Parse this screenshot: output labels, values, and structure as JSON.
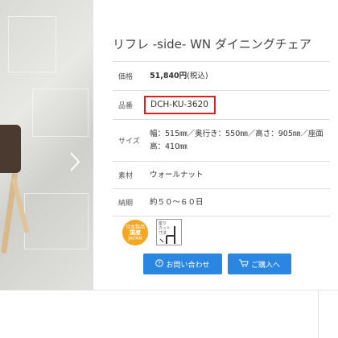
{
  "product": {
    "title": "リフレ -side- WN ダイニングチェア"
  },
  "spec": {
    "price_label": "価格",
    "price_value": "51,840円",
    "price_tax": "(税込)",
    "code_label": "品番",
    "code_value": "DCH-KU-3620",
    "size_label": "サイズ",
    "size_line1": "幅：515㎜／奥行き：550㎜／高さ：905㎜／座面",
    "size_line2": "高：410㎜",
    "material_label": "素材",
    "material_value": "ウォールナット",
    "delivery_label": "納期",
    "delivery_value": "約５０～６０日"
  },
  "badges": {
    "made": {
      "line1": "日本製品",
      "line2": "国産",
      "line3": "JAPAN"
    },
    "spec": {
      "line1": "座り",
      "line2": "カット",
      "line3": "寸法"
    }
  },
  "buttons": {
    "inquiry": "お問い合わせ",
    "buy": "ご購入へ"
  },
  "colors": {
    "button": "#2a86e0",
    "highlight": "#e02020",
    "badge": "#f5a623"
  }
}
